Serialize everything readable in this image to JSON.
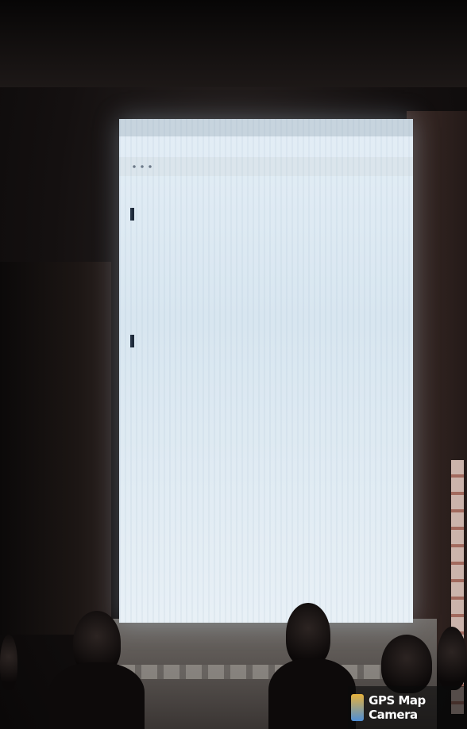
{
  "watermark": {
    "text": "GPS Map Camera",
    "icon": "map-pin-icon"
  },
  "projected_page": {
    "tab_title": "",
    "address": "",
    "results": [
      {
        "site": "",
        "url": "",
        "title": "",
        "snippet_lines": [
          "",
          "",
          ""
        ]
      },
      {
        "site": "",
        "url": "",
        "title": "",
        "snippet_lines": [
          "",
          ""
        ]
      }
    ],
    "pager": {
      "label": "",
      "links": ""
    },
    "footer_lines": [
      "",
      "",
      ""
    ]
  }
}
